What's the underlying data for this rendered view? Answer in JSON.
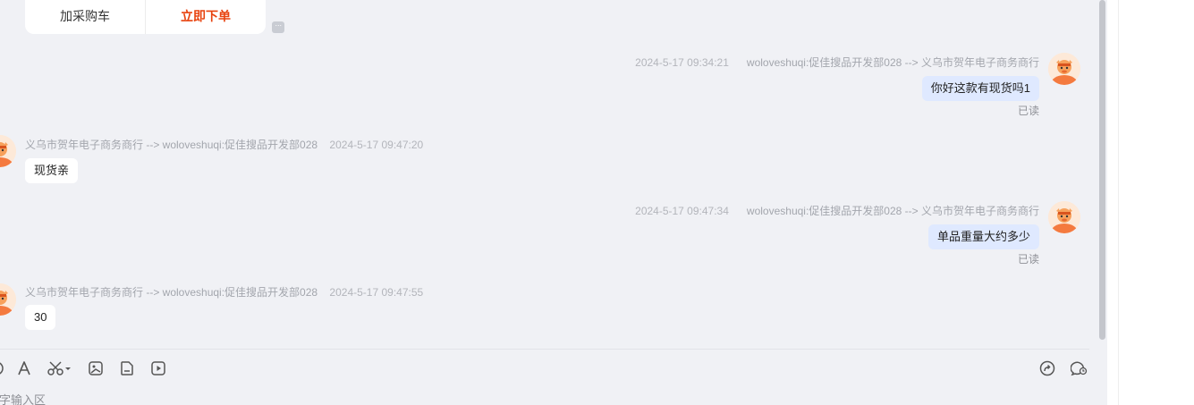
{
  "product_card": {
    "add_cart_label": "加采购车",
    "order_label": "立即下单"
  },
  "messages": [
    {
      "direction": "out",
      "time": "2024-5-17 09:34:21",
      "route": "woloveshuqi:促佳搜品开发部028 --> 义乌市贺年电子商务商行",
      "text": "你好这款有现货吗1",
      "status": "已读"
    },
    {
      "direction": "in",
      "route": "义乌市贺年电子商务商行 --> woloveshuqi:促佳搜品开发部028",
      "time": "2024-5-17 09:47:20",
      "text": "现货亲"
    },
    {
      "direction": "out",
      "time": "2024-5-17 09:47:34",
      "route": "woloveshuqi:促佳搜品开发部028 --> 义乌市贺年电子商务商行",
      "text": "单品重量大约多少",
      "status": "已读"
    },
    {
      "direction": "in",
      "route": "义乌市贺年电子商务商行 --> woloveshuqi:促佳搜品开发部028",
      "time": "2024-5-17 09:47:55",
      "text": "30"
    }
  ],
  "toolbar": {
    "icons": [
      "emoji-icon",
      "font-icon",
      "scissors-icon",
      "image-icon",
      "file-icon",
      "video-icon",
      "share-icon",
      "chat-history-icon"
    ]
  },
  "input": {
    "placeholder": "字输入区"
  },
  "colors": {
    "chat_background": "#f0f1f5",
    "outgoing_bubble": "#dfe9ff",
    "incoming_bubble": "#ffffff",
    "accent_orange": "#e8430f",
    "avatar_orange": "#f47a3f"
  }
}
